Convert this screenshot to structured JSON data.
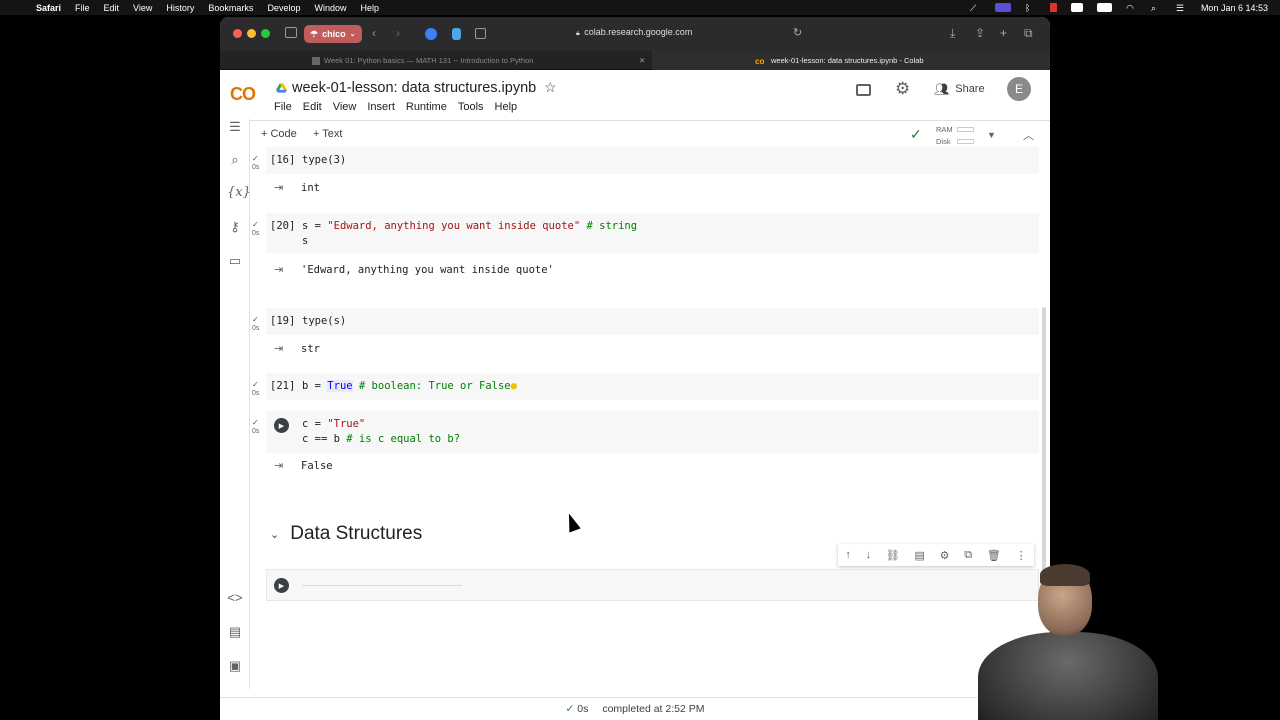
{
  "menubar": {
    "app": "Safari",
    "items": [
      "File",
      "Edit",
      "View",
      "History",
      "Bookmarks",
      "Develop",
      "Window",
      "Help"
    ],
    "clock": "Mon Jan 6  14:53"
  },
  "browser": {
    "profile": "chico",
    "url": "colab.research.google.com",
    "tabs": [
      {
        "title": "Week 01: Python basics — MATH 131 -- Introduction to Python",
        "active": false
      },
      {
        "title": "week-01-lesson: data structures.ipynb - Colab",
        "active": true
      }
    ]
  },
  "colab": {
    "logo": "CO",
    "notebook_title": "week-01-lesson: data structures.ipynb",
    "menus": [
      "File",
      "Edit",
      "View",
      "Insert",
      "Runtime",
      "Tools",
      "Help"
    ],
    "share_label": "Share",
    "avatar_letter": "E",
    "toolbar": {
      "add_code": "+ Code",
      "add_text": "+ Text",
      "ram_label": "RAM",
      "disk_label": "Disk"
    }
  },
  "cells": [
    {
      "exec_count": "[16]",
      "exec_time": "0s",
      "output": "int"
    },
    {
      "exec_count": "[20]",
      "exec_time": "0s",
      "output": "'Edward, anything you want inside quote'"
    },
    {
      "exec_count": "[19]",
      "exec_time": "0s",
      "output": "str"
    },
    {
      "exec_count": "[21]",
      "exec_time": "0s"
    },
    {
      "exec_count": "",
      "exec_time": "0s",
      "output": "False"
    }
  ],
  "code": {
    "c16": {
      "fn": "type(3)"
    },
    "c20": {
      "a": "s = ",
      "str": "\"Edward, anything you want inside quote\"",
      "cmt": " # string",
      "line2": "s"
    },
    "c19": {
      "fn": "type(s)"
    },
    "c21": {
      "a": "b = ",
      "kw": "True",
      "cmt": " # boolean: True or False"
    },
    "c_run": {
      "a": "c = ",
      "str": "\"True\"",
      "line2a": "c == b",
      "cmt": " # is c equal to b?"
    }
  },
  "section_title": "Data Structures",
  "status": {
    "time": "0s",
    "text": "completed at 2:52 PM"
  },
  "icons": {
    "rail": [
      "toc-icon",
      "search-icon",
      "variables-icon",
      "key-icon",
      "folder-icon",
      "code-snippets-icon",
      "command-palette-icon",
      "terminal-icon"
    ],
    "cell_tools": [
      "move-up-icon",
      "move-down-icon",
      "link-icon",
      "comment-icon",
      "settings-icon",
      "mirror-icon",
      "delete-icon",
      "more-icon"
    ]
  },
  "colors": {
    "accent_green": "#188038",
    "logo_orange": "#f9ab00"
  }
}
